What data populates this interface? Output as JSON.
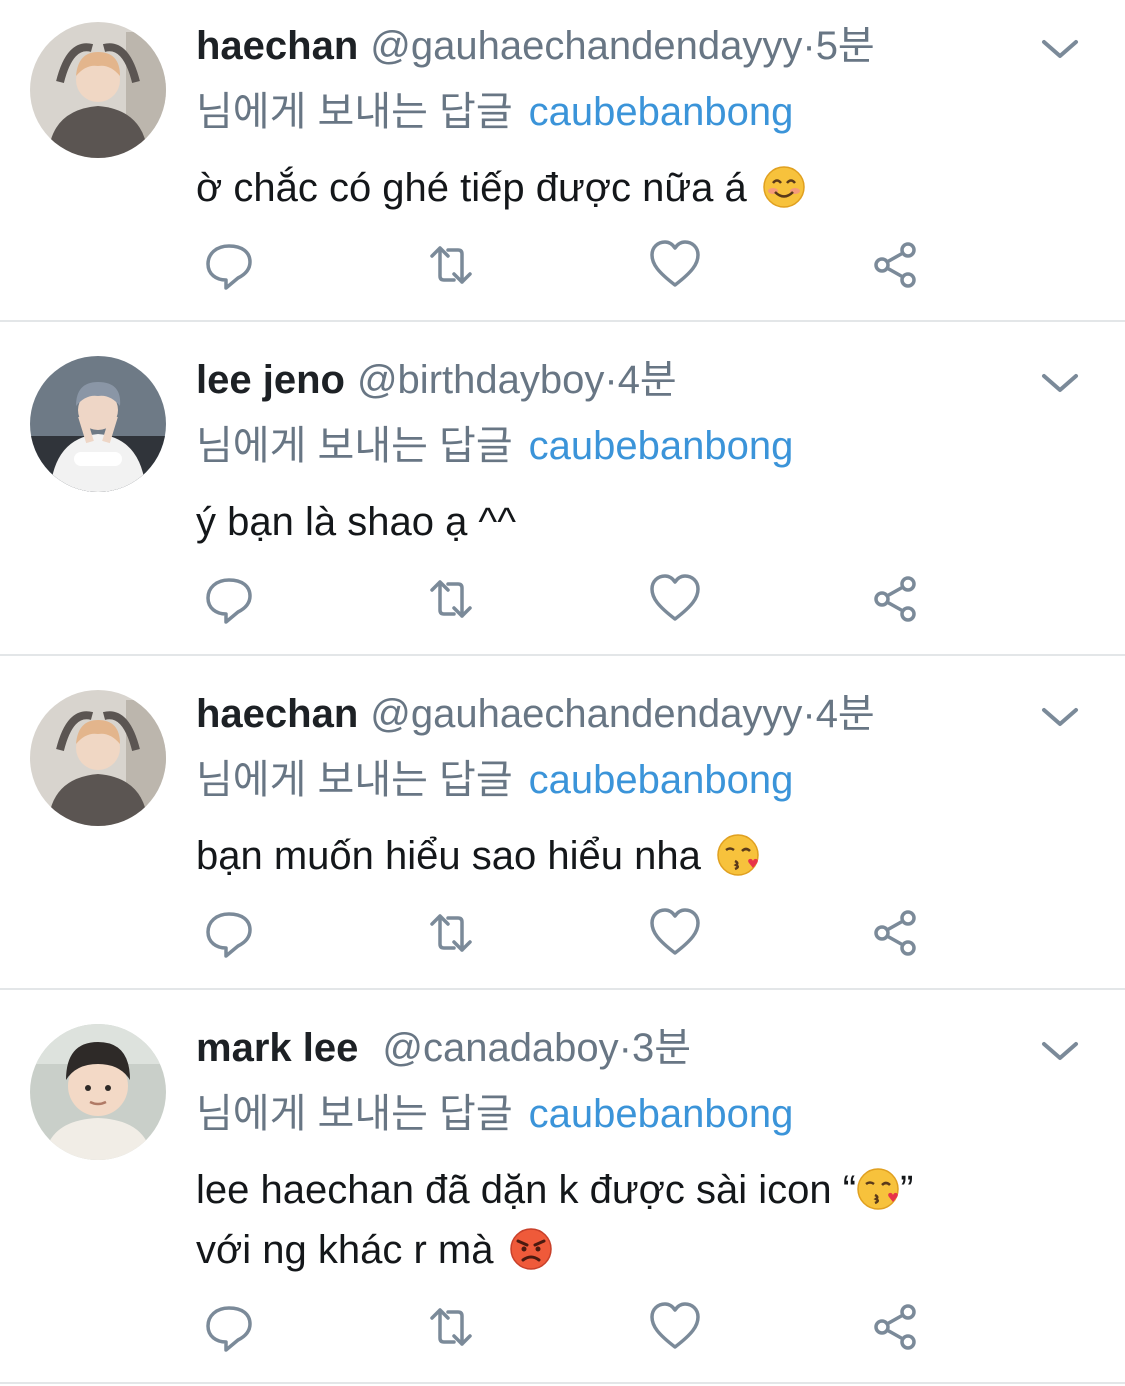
{
  "colors": {
    "name": "#1d2125",
    "secondary": "#687684",
    "link": "#3b94d9",
    "divider": "#e3e6e8",
    "icon": "#7b8a99"
  },
  "tweets": [
    {
      "name": "haechan",
      "handle": "@gauhaechandendayyy",
      "sep": "·",
      "time": "5분",
      "reply_prefix": "님에게 보내는 답글",
      "reply_to": "caubebanbong",
      "lines": [
        "ờ chắc có ghé tiếp được nữa á"
      ],
      "emojis": [
        "smiling-face-emoji"
      ]
    },
    {
      "name": "lee jeno",
      "handle": "@birthdayboy",
      "sep": "·",
      "time": "4분",
      "reply_prefix": "님에게 보내는 답글",
      "reply_to": "caubebanbong",
      "lines": [
        "ý bạn là shao ạ ^^"
      ],
      "emojis": []
    },
    {
      "name": "haechan",
      "handle": "@gauhaechandendayyy",
      "sep": "·",
      "time": "4분",
      "reply_prefix": "님에게 보내는 답글",
      "reply_to": "caubebanbong",
      "lines": [
        "bạn muốn hiểu sao hiểu nha"
      ],
      "emojis": [
        "face-blowing-kiss-emoji"
      ]
    },
    {
      "name": "mark lee",
      "handle": "@canadaboy",
      "sep": "·",
      "time": "3분",
      "reply_prefix": "님에게 보내는 답글",
      "reply_to": "caubebanbong",
      "lines": [
        "lee haechan đã dặn k được sài icon “",
        "” ",
        "với ng khác r mà"
      ],
      "emojis": [
        "face-blowing-kiss-emoji",
        "angry-face-emoji"
      ]
    }
  ],
  "action_icons": [
    "reply-icon",
    "retweet-icon",
    "like-icon",
    "share-icon"
  ]
}
